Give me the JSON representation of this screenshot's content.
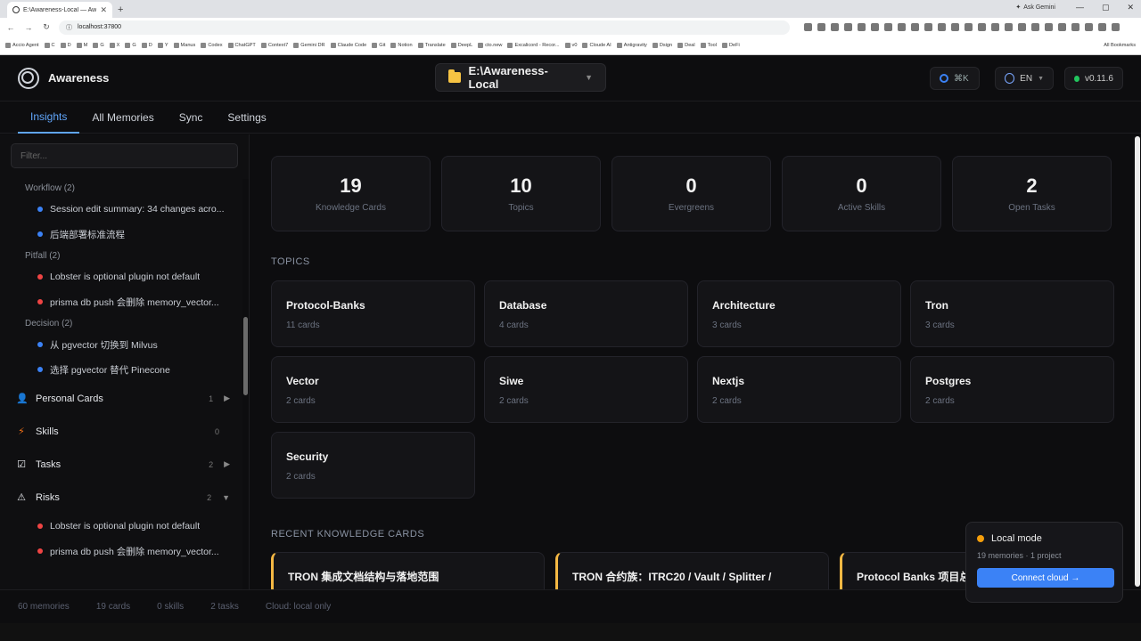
{
  "browser": {
    "tab_title": "E:\\Awareness-Local — Aware",
    "ask_gemini": "Ask Gemini",
    "url": "localhost:37800",
    "bookmarks": [
      "Accio Agent",
      "C",
      "D",
      "M",
      "G",
      "X",
      "G",
      "D",
      "Y",
      "Manus",
      "Codex",
      "ChatGPT",
      "Context7",
      "Gemini DR",
      "Claude Code",
      "Git",
      "Notion",
      "Translate",
      "DeepL",
      "cto.new",
      "Excalicord - Recor...",
      "v0",
      "Cloude AI",
      "Antigravity",
      "Dsign",
      "Deal",
      "Tool",
      "DeFi"
    ],
    "all_bookmarks": "All Bookmarks"
  },
  "header": {
    "brand": "Awareness",
    "folder": "E:\\Awareness-Local",
    "search_shortcut": "⌘K",
    "language": "EN",
    "version": "v0.11.6"
  },
  "tabs": [
    "Insights",
    "All Memories",
    "Sync",
    "Settings"
  ],
  "sidebar": {
    "filter_placeholder": "Filter...",
    "groups": [
      {
        "label": "Workflow (2)",
        "color": "#3b82f6",
        "items": [
          "Session edit summary: 34 changes acro...",
          "后端部署标准流程"
        ]
      },
      {
        "label": "Pitfall (2)",
        "color": "#ef4444",
        "items": [
          "Lobster is optional plugin not default",
          "prisma db push 会删除 memory_vector..."
        ]
      },
      {
        "label": "Decision (2)",
        "color": "#3b82f6",
        "items": [
          "从 pgvector 切换到 Milvus",
          "选择 pgvector 替代 Pinecone"
        ]
      }
    ],
    "sections": [
      {
        "label": "Personal Cards",
        "count": "1",
        "icon": "person-icon",
        "arrow": "▶"
      },
      {
        "label": "Skills",
        "count": "0",
        "icon": "bolt-icon",
        "arrow": ""
      },
      {
        "label": "Tasks",
        "count": "2",
        "icon": "checkbox-icon",
        "arrow": "▶"
      },
      {
        "label": "Risks",
        "count": "2",
        "icon": "warning-icon",
        "arrow": "▼"
      }
    ],
    "risk_items": [
      "Lobster is optional plugin not default",
      "prisma db push 会删除 memory_vector..."
    ]
  },
  "stats": [
    {
      "value": "19",
      "label": "Knowledge Cards"
    },
    {
      "value": "10",
      "label": "Topics"
    },
    {
      "value": "0",
      "label": "Evergreens"
    },
    {
      "value": "0",
      "label": "Active Skills"
    },
    {
      "value": "2",
      "label": "Open Tasks"
    }
  ],
  "topics_title": "TOPICS",
  "topics": [
    {
      "name": "Protocol-Banks",
      "count": "11 cards"
    },
    {
      "name": "Database",
      "count": "4 cards"
    },
    {
      "name": "Architecture",
      "count": "3 cards"
    },
    {
      "name": "Tron",
      "count": "3 cards"
    },
    {
      "name": "Vector",
      "count": "2 cards"
    },
    {
      "name": "Siwe",
      "count": "2 cards"
    },
    {
      "name": "Nextjs",
      "count": "2 cards"
    },
    {
      "name": "Postgres",
      "count": "2 cards"
    },
    {
      "name": "Security",
      "count": "2 cards"
    }
  ],
  "recent_title": "RECENT KNOWLEDGE CARDS",
  "recent_cards": [
    "TRON 集成文档结构与落地范围",
    "TRON 合约族：ITRC20 / Vault / Splitter /",
    "Protocol Banks 项目总"
  ],
  "toast": {
    "mode": "Local mode",
    "meta": "19 memories · 1 project",
    "button": "Connect cloud →"
  },
  "footer": [
    "60 memories",
    "19 cards",
    "0 skills",
    "2 tasks",
    "Cloud: local only"
  ]
}
